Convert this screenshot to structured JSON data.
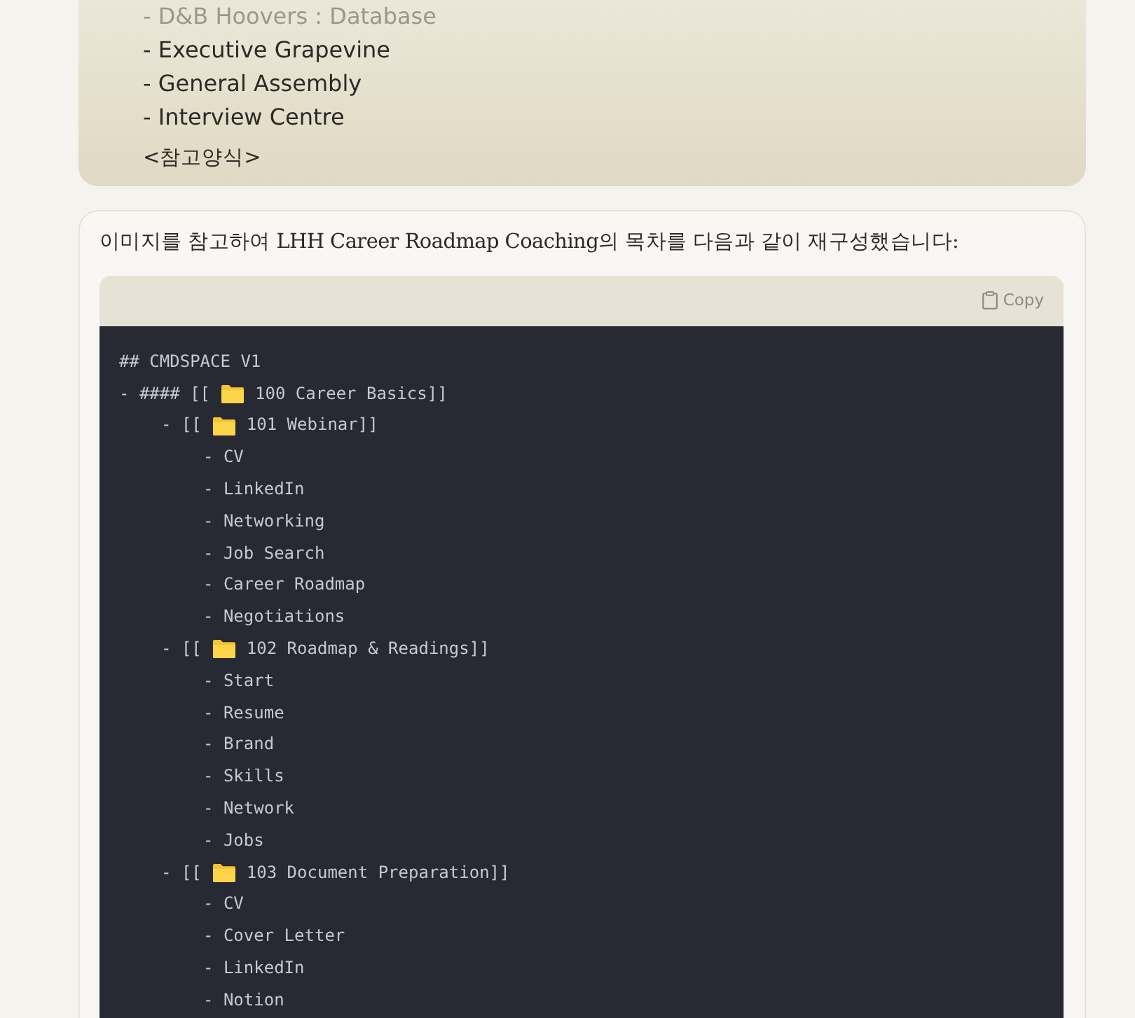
{
  "note_card": {
    "items": [
      {
        "text": "- D&B Hoovers : Database",
        "faded": true
      },
      {
        "text": "- Executive Grapevine",
        "faded": false
      },
      {
        "text": "- General Assembly",
        "faded": false
      },
      {
        "text": "- Interview Centre",
        "faded": false
      }
    ],
    "footer": "<참고양식>"
  },
  "reply": {
    "intro": "이미지를 참고하여 LHH Career Roadmap Coaching의 목차를 다음과 같이 재구성했습니다:",
    "code": {
      "copy_label": "Copy",
      "header": "## CMDSPACE V1",
      "tree": [
        {
          "kind": "folder",
          "before": "- #### [[",
          "after": "100 Career Basics]]",
          "children": [
            {
              "kind": "folder",
              "before": "- [[",
              "after": "101 Webinar]]",
              "children": [
                {
                  "kind": "item",
                  "text": "- CV"
                },
                {
                  "kind": "item",
                  "text": "- LinkedIn"
                },
                {
                  "kind": "item",
                  "text": "- Networking"
                },
                {
                  "kind": "item",
                  "text": "- Job Search"
                },
                {
                  "kind": "item",
                  "text": "- Career Roadmap"
                },
                {
                  "kind": "item",
                  "text": "- Negotiations"
                }
              ]
            },
            {
              "kind": "folder",
              "before": "- [[",
              "after": "102 Roadmap & Readings]]",
              "children": [
                {
                  "kind": "item",
                  "text": "- Start"
                },
                {
                  "kind": "item",
                  "text": "- Resume"
                },
                {
                  "kind": "item",
                  "text": "- Brand"
                },
                {
                  "kind": "item",
                  "text": "- Skills"
                },
                {
                  "kind": "item",
                  "text": "- Network"
                },
                {
                  "kind": "item",
                  "text": "- Jobs"
                }
              ]
            },
            {
              "kind": "folder",
              "before": "- [[",
              "after": "103 Document Preparation]]",
              "children": [
                {
                  "kind": "item",
                  "text": "- CV"
                },
                {
                  "kind": "item",
                  "text": "- Cover Letter"
                },
                {
                  "kind": "item",
                  "text": "- LinkedIn"
                },
                {
                  "kind": "item",
                  "text": "- Notion"
                }
              ]
            }
          ]
        }
      ]
    }
  }
}
